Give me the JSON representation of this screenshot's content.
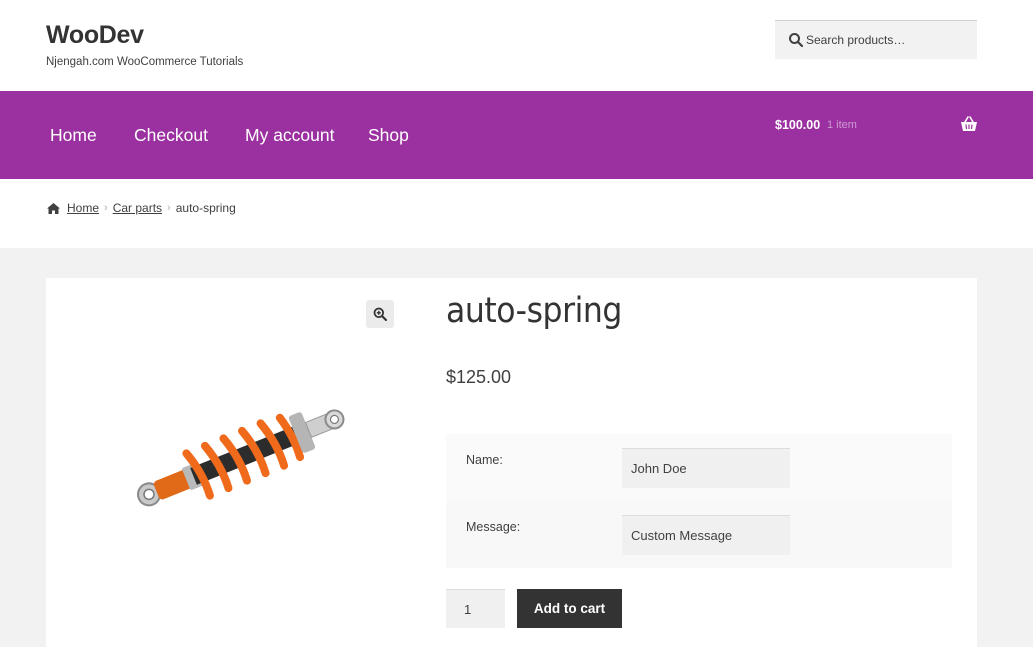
{
  "site": {
    "title": "WooDev",
    "tagline": "Njengah.com WooCommerce Tutorials"
  },
  "search": {
    "placeholder": "Search products…"
  },
  "nav": {
    "items": [
      {
        "label": "Home"
      },
      {
        "label": "Checkout"
      },
      {
        "label": "My account"
      },
      {
        "label": "Shop"
      }
    ]
  },
  "cart": {
    "amount": "$100.00",
    "count": "1 item",
    "icon": "basket-icon"
  },
  "breadcrumb": {
    "home": "Home",
    "category": "Car parts",
    "current": "auto-spring",
    "separator": "›"
  },
  "product": {
    "title": "auto-spring",
    "price": "$125.00",
    "image_icon": "shock-absorber-image",
    "zoom_icon": "zoom-in-icon",
    "addons": [
      {
        "label": "Name:",
        "value": "John Doe"
      },
      {
        "label": "Message:",
        "value": "Custom Message"
      }
    ],
    "quantity": "1",
    "add_to_cart_label": "Add to cart"
  },
  "colors": {
    "accent": "#9b30a0",
    "button": "#333333"
  }
}
